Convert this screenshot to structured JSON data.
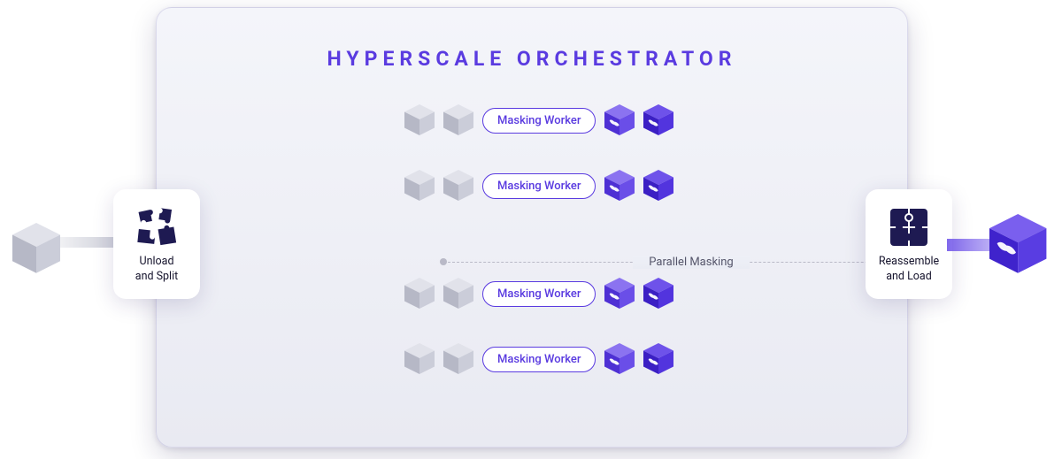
{
  "title": "HYPERSCALE ORCHESTRATOR",
  "left_card": {
    "label_line1": "Unload",
    "label_line2": "and Split"
  },
  "right_card": {
    "label_line1": "Reassemble",
    "label_line2": "and Load"
  },
  "workers": [
    {
      "label": "Masking Worker"
    },
    {
      "label": "Masking Worker"
    },
    {
      "label": "Masking Worker"
    },
    {
      "label": "Masking Worker"
    }
  ],
  "divider_label": "Parallel Masking",
  "colors": {
    "accent": "#5a3be0",
    "accent_dark": "#4528d6",
    "gray_cube_light": "#d6d7e1",
    "gray_cube_dark": "#b9bbc9",
    "ink": "#16142d"
  }
}
